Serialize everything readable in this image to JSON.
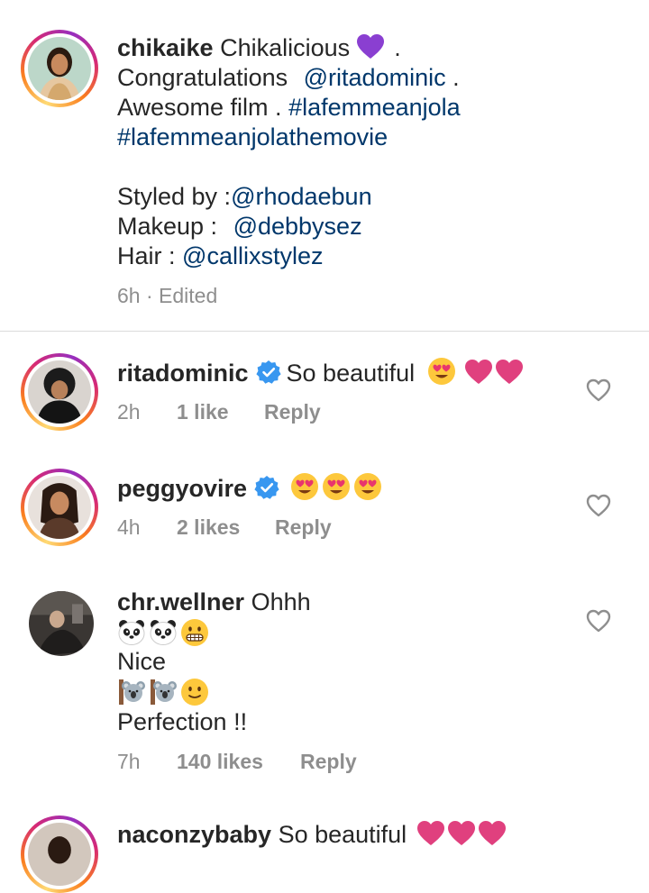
{
  "caption": {
    "username": "chikaike",
    "line1_text": "Chikalicious",
    "line1_after": ".",
    "line2_text": "Congratulations",
    "line2_mention": "@ritadominic",
    "line2_after": ".",
    "line3_text": "Awesome film .",
    "line3_tag": "#lafemmeanjola",
    "line4_tag": "#lafemmeanjolathemovie",
    "styled_label": "Styled by :",
    "styled_mention": "@rhodaebun",
    "makeup_label": "Makeup :",
    "makeup_mention": "@debbysez",
    "hair_label": "Hair :",
    "hair_mention": "@callixstylez",
    "time": "6h",
    "edited": "· Edited",
    "emoji": "purple-heart-icon"
  },
  "comments": [
    {
      "username": "ritadominic",
      "verified": true,
      "text": "So beautiful",
      "emojis": [
        "heart-eyes-icon",
        "pink-heart-icon",
        "pink-heart-icon"
      ],
      "time": "2h",
      "likes": "1 like",
      "reply": "Reply"
    },
    {
      "username": "peggyovire",
      "verified": true,
      "text": "",
      "emojis": [
        "heart-eyes-icon",
        "heart-eyes-icon",
        "heart-eyes-icon"
      ],
      "time": "4h",
      "likes": "2 likes",
      "reply": "Reply"
    },
    {
      "username": "chr.wellner",
      "verified": false,
      "text": "Ohhh",
      "line2_emojis": [
        "panda-icon",
        "panda-icon",
        "grimace-icon"
      ],
      "line3": "Nice",
      "line4_emojis": [
        "koala-icon",
        "koala-icon",
        "smile-icon"
      ],
      "line5": "Perfection !!",
      "time": "7h",
      "likes": "140 likes",
      "reply": "Reply"
    },
    {
      "username": "naconzybaby",
      "text": "So beautiful",
      "emojis": [
        "pink-heart-icon",
        "pink-heart-icon",
        "pink-heart-icon"
      ]
    }
  ],
  "colors": {
    "link": "#00376b",
    "meta": "#8e8e8e",
    "verified": "#3897f0",
    "purple_heart": "#8a3fd1",
    "pink_heart": "#e0407e"
  }
}
